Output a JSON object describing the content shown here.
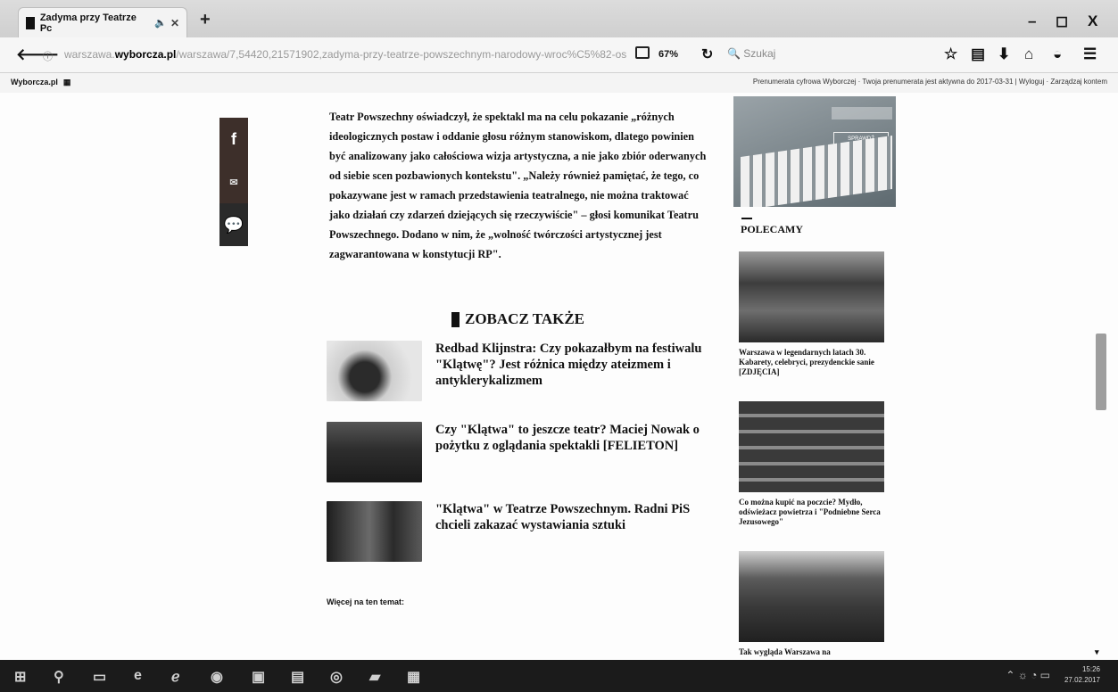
{
  "browser": {
    "tab_title": "Zadyma przy Teatrze Pc",
    "tab_audio_icon": "speaker-icon",
    "new_tab_label": "+",
    "url_prefix": "warszawa.",
    "url_domain": "wyborcza.pl",
    "url_path": "/warszawa/7,54420,21571902,zadyma-przy-teatrze-powszechnym-narodowy-wroc%C5%82-os",
    "zoom_label": "67%",
    "search_placeholder": "Szukaj",
    "window_controls": [
      "–",
      "◻",
      "X"
    ]
  },
  "bookmarks": {
    "left_label": "Wyborcza.pl",
    "right_text": "Prenumerata cyfrowa Wyborczej · Twoja prenumerata jest aktywna do 2017-03-31 | Wyloguj · Zarządzaj kontem"
  },
  "share": {
    "facebook": "f",
    "mail": "✉",
    "comment": "💬"
  },
  "article": {
    "paragraph": "Teatr Powszechny oświadczył, że spektakl ma na celu pokazanie „różnych ideologicznych postaw i oddanie głosu różnym stanowiskom, dlatego powinien być analizowany jako całościowa wizja artystyczna, a nie jako zbiór oderwanych od siebie scen pozbawionych kontekstu\". „Należy również pamiętać, że tego, co pokazywane jest w ramach przedstawienia teatralnego, nie można traktować jako działań czy zdarzeń dziejących się rzeczywiście\" – głosi komunikat Teatru Powszechnego. Dodano w nim, że „wolność twórczości artystycznej jest zagwarantowana w konstytucji RP\"."
  },
  "see_also": {
    "heading": "ZOBACZ TAKŻE",
    "items": [
      {
        "title": "Redbad Klijnstra: Czy pokazałbym na festiwalu \"Klątwę\"? Jest różnica między ateizmem i antyklerykalizmem"
      },
      {
        "title": "Czy \"Klątwa\" to jeszcze teatr? Maciej Nowak o pożytku z oglądania spektakli [FELIETON]"
      },
      {
        "title": "\"Klątwa\" w Teatrze Powszechnym. Radni PiS chcieli zakazać wystawiania sztuki"
      }
    ],
    "more_label": "Więcej na ten temat:"
  },
  "sidebar": {
    "ad_button": "SPRAWDŹ",
    "section_title": "POLECAMY",
    "items": [
      {
        "caption": "Warszawa w legendarnych latach 30. Kabarety, celebryci, prezydenckie sanie [ZDJĘCIA]"
      },
      {
        "caption": "Co można kupić na poczcie? Mydło, odświeżacz powietrza i \"Podniebne Serca Jezusowego\""
      },
      {
        "caption": "Tak wygląda Warszawa na"
      }
    ]
  },
  "taskbar": {
    "clock_time": "15:26",
    "clock_date": "27.02.2017"
  }
}
